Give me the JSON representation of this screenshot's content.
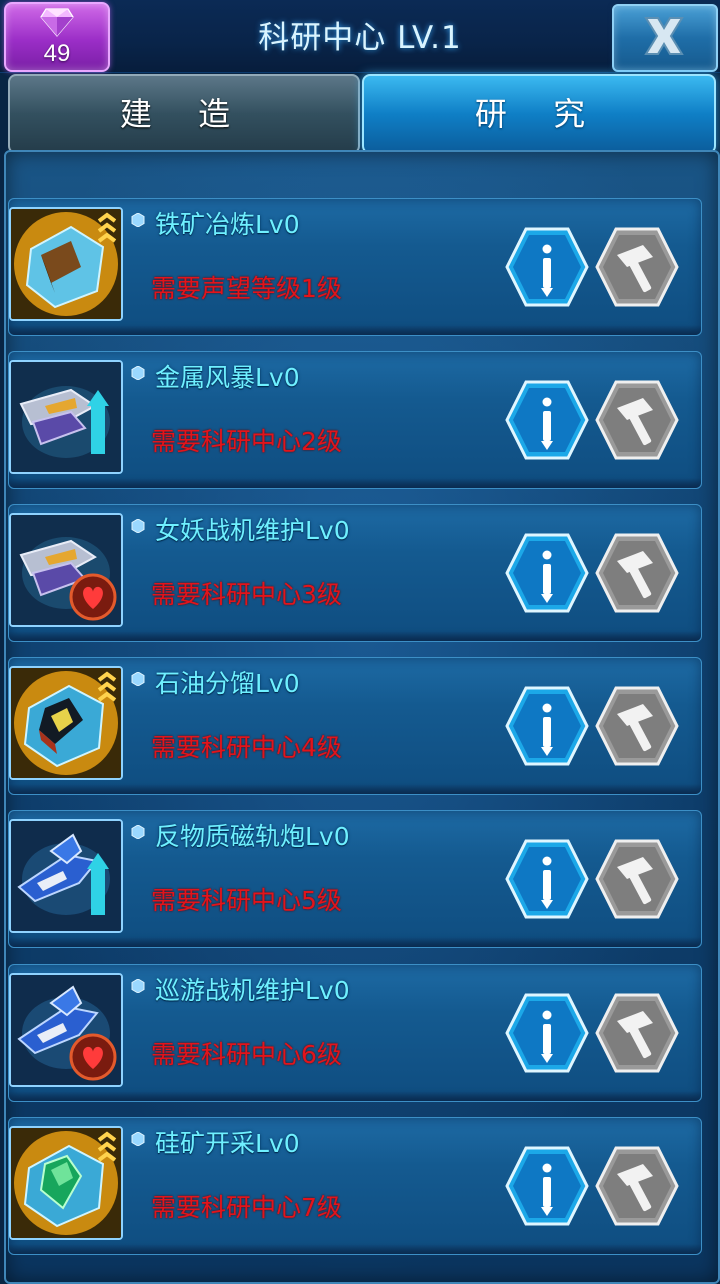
{
  "header": {
    "gem_count": "49",
    "title": "科研中心 LV.1"
  },
  "tabs": [
    {
      "label": "建 造",
      "active": false
    },
    {
      "label": "研 究",
      "active": true
    }
  ],
  "research_items": [
    {
      "name": "铁矿冶炼Lv0",
      "requirement": "需要声望等级1级",
      "icon": "iron-ore-cube-icon"
    },
    {
      "name": "金属风暴Lv0",
      "requirement": "需要科研中心2级",
      "icon": "fighter-jet-upgrade-icon"
    },
    {
      "name": "女妖战机维护Lv0",
      "requirement": "需要科研中心3级",
      "icon": "fighter-jet-repair-heart-icon"
    },
    {
      "name": "石油分馏Lv0",
      "requirement": "需要科研中心4级",
      "icon": "oil-cube-icon"
    },
    {
      "name": "反物质磁轨炮Lv0",
      "requirement": "需要科研中心5级",
      "icon": "blue-jet-upgrade-icon"
    },
    {
      "name": "巡游战机维护Lv0",
      "requirement": "需要科研中心6级",
      "icon": "blue-jet-repair-heart-icon"
    },
    {
      "name": "硅矿开采Lv0",
      "requirement": "需要科研中心7级",
      "icon": "silicon-crystal-cube-icon"
    }
  ],
  "colors": {
    "item_name": "#6ff0ff",
    "requirement": "#e2141b",
    "active_tab": "#1089d0",
    "gem_box": "#9b2ec7"
  }
}
